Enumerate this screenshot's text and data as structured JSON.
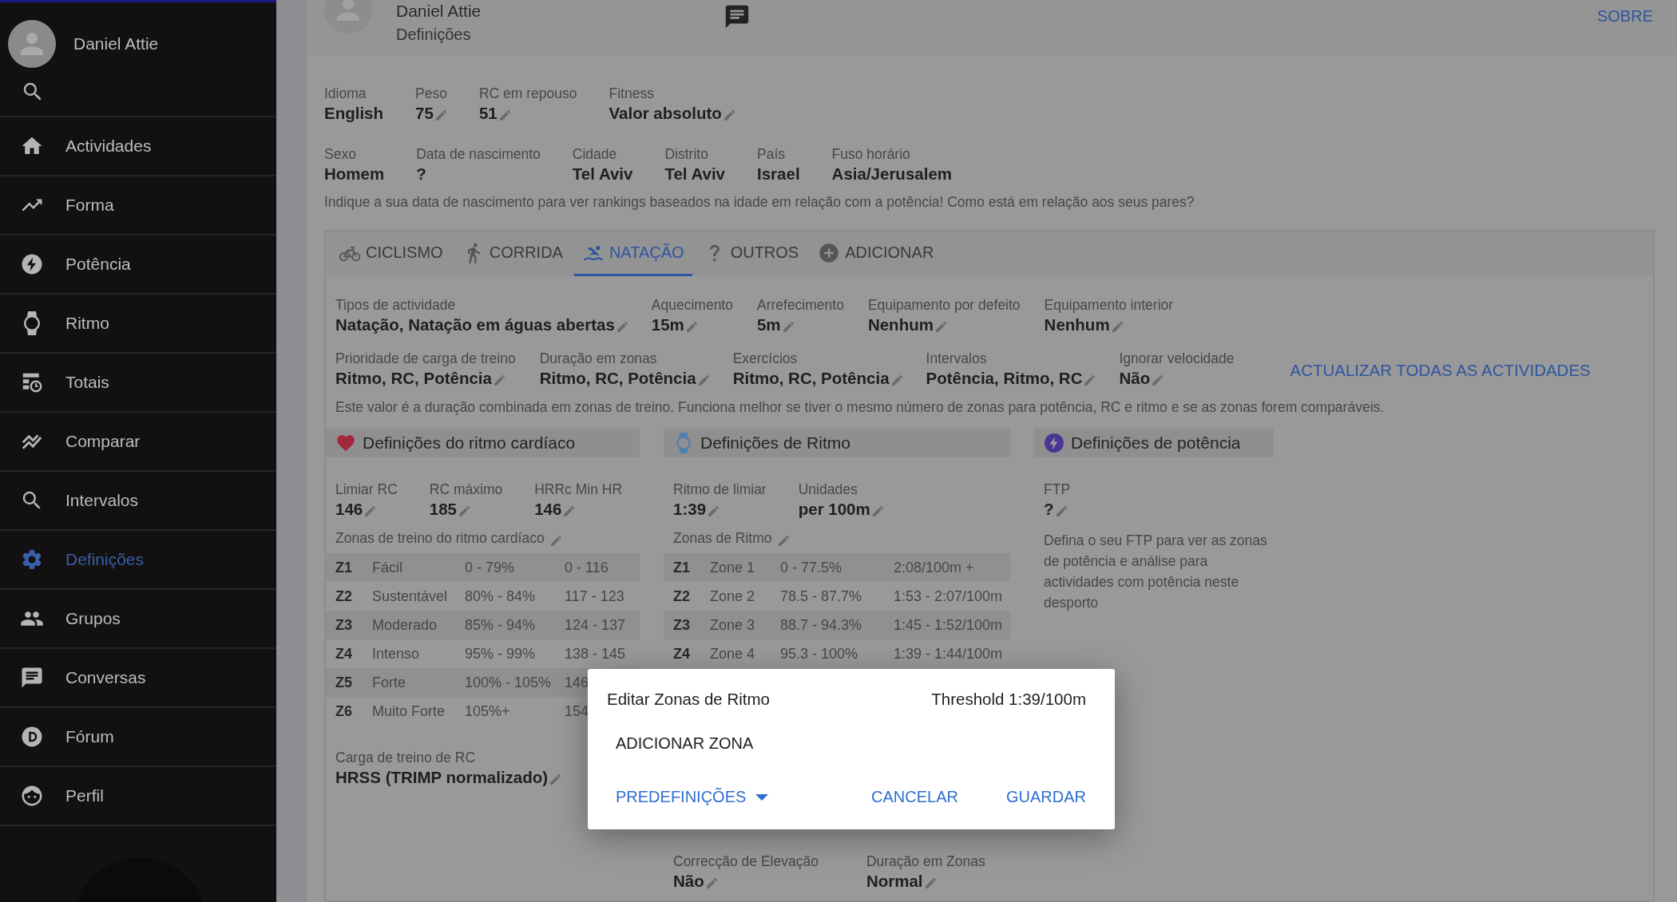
{
  "sidebar": {
    "user": "Daniel Attie",
    "items": [
      {
        "label": "Actividades",
        "selected": false
      },
      {
        "label": "Forma",
        "selected": false
      },
      {
        "label": "Potência",
        "selected": false
      },
      {
        "label": "Ritmo",
        "selected": false
      },
      {
        "label": "Totais",
        "selected": false
      },
      {
        "label": "Comparar",
        "selected": false
      },
      {
        "label": "Intervalos",
        "selected": false
      },
      {
        "label": "Definições",
        "selected": true
      },
      {
        "label": "Grupos",
        "selected": false
      },
      {
        "label": "Conversas",
        "selected": false
      },
      {
        "label": "Fórum",
        "selected": false
      },
      {
        "label": "Perfil",
        "selected": false
      }
    ]
  },
  "header": {
    "name": "Daniel Attie",
    "subtitle": "Definições",
    "about": "SOBRE"
  },
  "profile": {
    "fields_top": [
      {
        "label": "Idioma",
        "value": "English",
        "editable": false
      },
      {
        "label": "Peso",
        "value": "75",
        "editable": true
      },
      {
        "label": "RC em repouso",
        "value": "51",
        "editable": true
      },
      {
        "label": "Fitness",
        "value": "Valor absoluto",
        "editable": true
      }
    ],
    "fields_bottom": [
      {
        "label": "Sexo",
        "value": "Homem",
        "editable": false
      },
      {
        "label": "Data de nascimento",
        "value": "?",
        "editable": false
      },
      {
        "label": "Cidade",
        "value": "Tel Aviv",
        "editable": false
      },
      {
        "label": "Distrito",
        "value": "Tel Aviv",
        "editable": false
      },
      {
        "label": "País",
        "value": "Israel",
        "editable": false
      },
      {
        "label": "Fuso horário",
        "value": "Asia/Jerusalem",
        "editable": false
      }
    ],
    "hint": "Indique a sua data de nascimento para ver rankings baseados na idade em relação com a potência! Como está em relação aos seus pares?"
  },
  "sport_tabs": [
    {
      "label": "CICLISMO",
      "selected": false
    },
    {
      "label": "CORRIDA",
      "selected": false
    },
    {
      "label": "NATAÇÃO",
      "selected": true
    },
    {
      "label": "OUTROS",
      "selected": false
    },
    {
      "label": "ADICIONAR",
      "selected": false
    }
  ],
  "sport_settings": {
    "fields_top": [
      {
        "label": "Tipos de actividade",
        "value": "Natação, Natação em águas abertas",
        "editable": true
      },
      {
        "label": "Aquecimento",
        "value": "15m",
        "editable": true
      },
      {
        "label": "Arrefecimento",
        "value": "5m",
        "editable": true
      },
      {
        "label": "Equipamento por defeito",
        "value": "Nenhum",
        "editable": true
      },
      {
        "label": "Equipamento interior",
        "value": "Nenhum",
        "editable": true
      }
    ],
    "fields_bottom": [
      {
        "label": "Prioridade de carga de treino",
        "value": "Ritmo, RC, Potência",
        "editable": true
      },
      {
        "label": "Duração em zonas",
        "value": "Ritmo, RC, Potência",
        "editable": true
      },
      {
        "label": "Exercícios",
        "value": "Ritmo, RC, Potência",
        "editable": true
      },
      {
        "label": "Intervalos",
        "value": "Potência, Ritmo, RC",
        "editable": true
      },
      {
        "label": "Ignorar velocidade",
        "value": "Não",
        "editable": true
      }
    ],
    "update_link": "ACTUALIZAR TODAS AS ACTIVIDADES",
    "note": "Este valor é a duração combinada em zonas de treino. Funciona melhor se tiver o mesmo número de zonas para potência, RC e ritmo e se as zonas forem comparáveis."
  },
  "heart": {
    "title": "Definições do ritmo cardíaco",
    "fields": [
      {
        "label": "Limiar RC",
        "value": "146",
        "editable": true
      },
      {
        "label": "RC máximo",
        "value": "185",
        "editable": true
      },
      {
        "label": "HRRc Min HR",
        "value": "146",
        "editable": true
      }
    ],
    "zones_label": {
      "text": "Zonas de treino do ritmo cardíaco",
      "editable": true
    },
    "zones": [
      {
        "zone": "Z1",
        "name": "Fácil",
        "percent": "0 - 79%",
        "range": "0 - 116"
      },
      {
        "zone": "Z2",
        "name": "Sustentável",
        "percent": "80% - 84%",
        "range": "117 - 123"
      },
      {
        "zone": "Z3",
        "name": "Moderado",
        "percent": "85% - 94%",
        "range": "124 - 137"
      },
      {
        "zone": "Z4",
        "name": "Intenso",
        "percent": "95% - 99%",
        "range": "138 - 145"
      },
      {
        "zone": "Z5",
        "name": "Forte",
        "percent": "100% - 105%",
        "range": "146"
      },
      {
        "zone": "Z6",
        "name": "Muito Forte",
        "percent": "105%+",
        "range": "154"
      }
    ],
    "load": {
      "label": "Carga de treino de RC",
      "value": "HRSS (TRIMP normalizado)",
      "editable": true
    }
  },
  "pace": {
    "title": "Definições de Ritmo",
    "fields": [
      {
        "label": "Ritmo de limiar",
        "value": "1:39",
        "editable": true
      },
      {
        "label": "Unidades",
        "value": "per 100m",
        "editable": true
      }
    ],
    "zones_label": {
      "text": "Zonas de Ritmo",
      "editable": true
    },
    "zones": [
      {
        "zone": "Z1",
        "name": "Zone 1",
        "percent": "0 - 77.5%",
        "range": "2:08/100m +"
      },
      {
        "zone": "Z2",
        "name": "Zone 2",
        "percent": "78.5 - 87.7%",
        "range": "1:53 - 2:07/100m"
      },
      {
        "zone": "Z3",
        "name": "Zone 3",
        "percent": "88.7 - 94.3%",
        "range": "1:45 - 1:52/100m"
      },
      {
        "zone": "Z4",
        "name": "Zone 4",
        "percent": "95.3 - 100%",
        "range": "1:39 - 1:44/100m"
      }
    ],
    "bottom_fields": [
      {
        "label": "Correcção de Elevação",
        "value": "Não",
        "editable": true
      },
      {
        "label": "Duração em Zonas",
        "value": "Normal",
        "editable": true
      }
    ]
  },
  "power": {
    "title": "Definições de potência",
    "fields": [
      {
        "label": "FTP",
        "value": "?",
        "editable": true
      }
    ],
    "note": "Defina o seu FTP para ver as zonas de potência e análise para actividades com potência neste desporto"
  },
  "dialog": {
    "title": "Editar Zonas de Ritmo",
    "threshold": "Threshold 1:39/100m",
    "add_zone": "ADICIONAR ZONA",
    "presets": "PREDEFINIÇÕES",
    "cancel": "CANCELAR",
    "save": "GUARDAR"
  }
}
